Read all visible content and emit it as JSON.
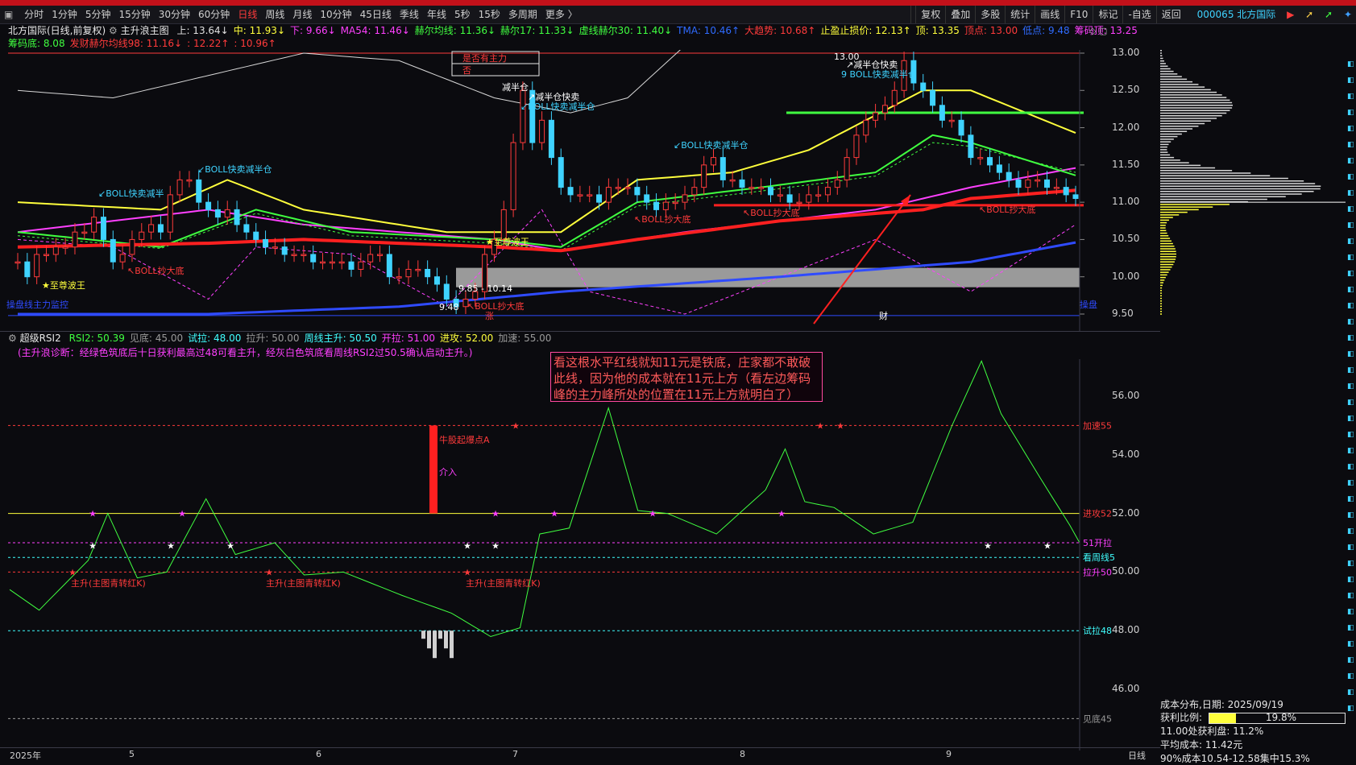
{
  "toolbar": {
    "periods": [
      "分时",
      "1分钟",
      "5分钟",
      "15分钟",
      "30分钟",
      "60分钟",
      "日线",
      "周线",
      "月线",
      "10分钟",
      "45日线",
      "季线",
      "年线",
      "5秒",
      "15秒",
      "多周期",
      "更多 〉"
    ],
    "active": "日线",
    "right": [
      "复权",
      "叠加",
      "多股",
      "统计",
      "画线",
      "F10",
      "标记",
      "-自选",
      "返回"
    ],
    "stock": "000065 北方国际"
  },
  "main_info": {
    "title": "北方国际(日线,前复权)",
    "indicator": "主升浪主图",
    "items": [
      {
        "t": "上: 13.64↓",
        "c": "#e0e0e0"
      },
      {
        "t": "中: 11.93↓",
        "c": "#ffff3c"
      },
      {
        "t": "下: 9.66↓",
        "c": "#ff40ff"
      },
      {
        "t": "MA54: 11.46↓",
        "c": "#ff40ff"
      },
      {
        "t": "赫尔均线: 11.36↓",
        "c": "#40ff40"
      },
      {
        "t": "赫尔17: 11.33↓",
        "c": "#40ff40"
      },
      {
        "t": "虚线赫尔30: 11.40↓",
        "c": "#40ff40"
      },
      {
        "t": "TMA: 10.46↑",
        "c": "#2f6bff"
      },
      {
        "t": "大趋势: 10.68↑",
        "c": "#ff3b3b"
      },
      {
        "t": "止盈止损价: 12.13↑",
        "c": "#ffff3c"
      },
      {
        "t": "顶: 13.35",
        "c": "#ffff3c"
      },
      {
        "t": "顶点: 13.00",
        "c": "#ff3b3b"
      },
      {
        "t": "低点: 9.48",
        "c": "#2f6bff"
      },
      {
        "t": "筹码顶: 13.25",
        "c": "#ff40ff"
      }
    ],
    "items2": [
      {
        "t": "筹码底: 8.08",
        "c": "#40ff40"
      },
      {
        "t": "发财赫尔均线98: 11.16↓",
        "c": "#ff3b3b"
      },
      {
        "t": ": 12.22↑",
        "c": "#ff3b3b"
      },
      {
        "t": ": 10.96↑",
        "c": "#ff3b3b"
      }
    ]
  },
  "price_axis": [
    "13.00",
    "12.50",
    "12.00",
    "11.50",
    "11.00",
    "10.50",
    "10.00",
    "9.50"
  ],
  "rsi_axis": [
    "56.00",
    "54.00",
    "52.00",
    "50.00",
    "48.00",
    "46.00"
  ],
  "date_axis": [
    "2025年",
    "5",
    "6",
    "7",
    "8",
    "9"
  ],
  "date_axis_right": "日线",
  "chart_labels": {
    "sell1": "↙BOLL快卖减半",
    "sell2": "↙BOLL快卖减半仓",
    "sell3": "↙BOLL快卖减半仓",
    "sell4": "↙BOLL快卖减半仓",
    "sell5": "9 BOLL快卖减半仓",
    "jian1": "减半仓",
    "jian2": "↗减半仓快卖",
    "jian3": "↗减半仓快卖",
    "top_price": "13.00",
    "buy1": "↖BOLL抄大底",
    "buy2": "↖BOLL抄大底",
    "buy3": "↖BOLL抄大底",
    "buy4": "↖BOLL抄大底",
    "buy5": "↖BOLL抄大底",
    "zzb1": "★至尊波王",
    "zzb2": "★至尊波王",
    "low_price": "9.48",
    "range": "9.85 - 10.14",
    "zhang": "涨",
    "cai": "财",
    "box1": "是否有主力",
    "box2": "否",
    "left_label": "操盘线主力监控",
    "right_label": "操盘"
  },
  "rsi_info": {
    "name": "超级RSI2",
    "items": [
      {
        "t": "RSI2: 50.39",
        "c": "#40ff40"
      },
      {
        "t": "见底: 45.00",
        "c": "#9a9a9a"
      },
      {
        "t": "试拉: 48.00",
        "c": "#40ffff"
      },
      {
        "t": "拉升: 50.00",
        "c": "#9a9a9a"
      },
      {
        "t": "周线主升: 50.50",
        "c": "#40ffff"
      },
      {
        "t": "开拉: 51.00",
        "c": "#ff40ff"
      },
      {
        "t": "进攻: 52.00",
        "c": "#ffff3c"
      },
      {
        "t": "加速: 55.00",
        "c": "#9a9a9a"
      }
    ],
    "note": "(主升浪诊断：经绿色筑底后十日获利最高过48可看主升，经灰白色筑底看周线RSI2过50.5确认启动主升。)"
  },
  "rsi_lines": [
    {
      "label": "加速55",
      "c": "#ff3b3b"
    },
    {
      "label": "进攻52",
      "c": "#ff3b3b"
    },
    {
      "label": "51开拉",
      "c": "#ff40ff"
    },
    {
      "label": "看周线5",
      "c": "#40ffff"
    },
    {
      "label": "拉升50",
      "c": "#ff40ff"
    },
    {
      "label": "试拉48",
      "c": "#40ffff"
    },
    {
      "label": "见底45",
      "c": "#9a9a9a"
    }
  ],
  "rsi_labels": {
    "bao": "牛股起爆点A",
    "jieru": "介入",
    "zs1": "主升(主图青转红K)",
    "zs2": "主升(主图青转红K)",
    "zs3": "主升(主图青转红K)"
  },
  "annotation": "看这根水平红线就知11元是铁底，庄家都不敢破此线，因为他的成本就在11元上方（看左边筹码峰的主力峰所处的位置在11元上方就明白了）",
  "cost": {
    "title": "成本分布,日期:  2025/09/19",
    "ratio_label": "获利比例:",
    "ratio": "19.8%",
    "ratio_value": 0.198,
    "line1": "11.00处获利盘: 11.2%",
    "line2": "平均成本: 11.42元",
    "line3": "90%成本10.54-12.58集中15.3%"
  },
  "colors": {
    "up": "#ff3b3b",
    "down": "#3fd3ff",
    "bg": "#0b0b0f"
  }
}
